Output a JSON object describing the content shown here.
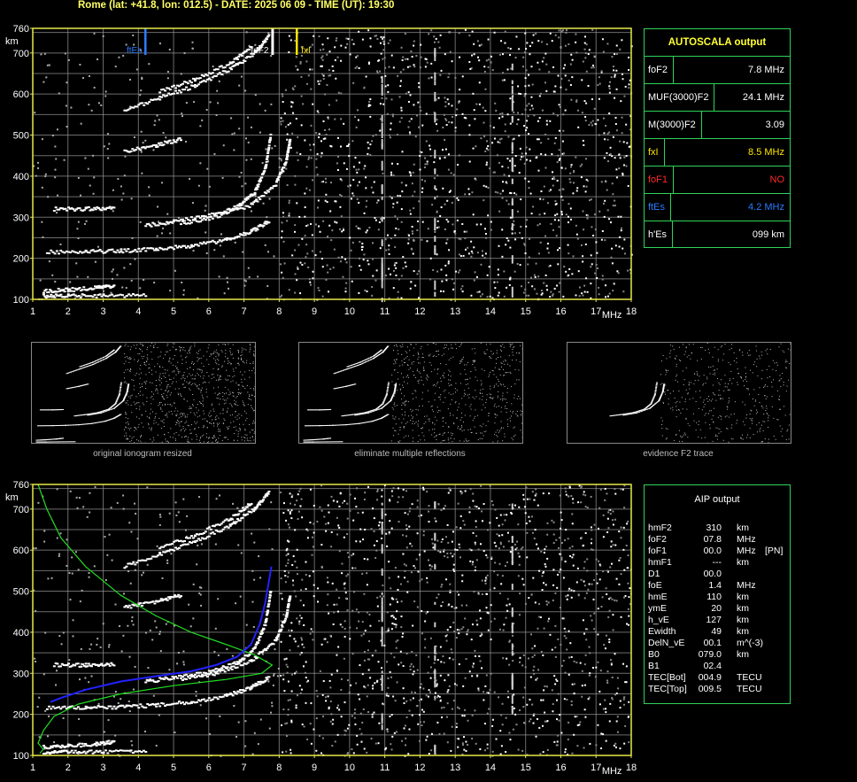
{
  "header": "Rome (lat: +41.8, lon: 012.5) - DATE: 2025 06 09 - TIME (UT): 19:30",
  "axis": {
    "y_unit": "km",
    "x_unit": "MHz",
    "y_ticks": [
      "100",
      "200",
      "300",
      "400",
      "500",
      "600",
      "700",
      "760"
    ],
    "x_ticks": [
      "1",
      "2",
      "3",
      "4",
      "5",
      "6",
      "7",
      "8",
      "9",
      "10",
      "11",
      "12",
      "13",
      "14",
      "15",
      "16",
      "17",
      "18"
    ]
  },
  "markers": {
    "ftEs": "ftEs",
    "foF2": "foF2",
    "fxI": "fxI"
  },
  "colors": {
    "frame": "#e8e84a",
    "grid": "#9a9a9a",
    "panel": "#2fd35a",
    "ftEs": "#2a7cff",
    "fxI": "#ffe600",
    "foF1": "#ff2a2a",
    "model": "#22dd22",
    "profile": "#2222ff"
  },
  "autoscala": {
    "title": "AUTOSCALA output",
    "rows": [
      {
        "label": "foF2",
        "value": "7.8 MHz",
        "color": "#ffffff"
      },
      {
        "label": "MUF(3000)F2",
        "value": "24.1 MHz",
        "color": "#ffffff"
      },
      {
        "label": "M(3000)F2",
        "value": "3.09",
        "color": "#ffffff"
      },
      {
        "label": "fxI",
        "value": "8.5 MHz",
        "color": "#ffe600"
      },
      {
        "label": "foF1",
        "value": "NO",
        "color": "#ff2a2a"
      },
      {
        "label": "ftEs",
        "value": "4.2 MHz",
        "color": "#2a7cff"
      },
      {
        "label": "h'Es",
        "value": "099   km",
        "color": "#ffffff"
      }
    ]
  },
  "thumb_captions": [
    "original ionogram resized",
    "eliminate multiple reflections",
    "evidence F2 trace"
  ],
  "aip": {
    "title": "AIP output",
    "rows": [
      {
        "name": "hmF2",
        "value": "310",
        "unit": "km",
        "extra": ""
      },
      {
        "name": "foF2",
        "value": "07.8",
        "unit": "MHz",
        "extra": ""
      },
      {
        "name": "foF1",
        "value": "00.0",
        "unit": "MHz",
        "extra": "[PN]"
      },
      {
        "name": "hmF1",
        "value": "---",
        "unit": "km",
        "extra": ""
      },
      {
        "name": "D1",
        "value": "00.0",
        "unit": "",
        "extra": ""
      },
      {
        "name": "foE",
        "value": "1.4",
        "unit": "MHz",
        "extra": ""
      },
      {
        "name": "hmE",
        "value": "110",
        "unit": "km",
        "extra": ""
      },
      {
        "name": "ymE",
        "value": "20",
        "unit": "km",
        "extra": ""
      },
      {
        "name": "h_vE",
        "value": "127",
        "unit": "km",
        "extra": ""
      },
      {
        "name": "Ewidth",
        "value": "49",
        "unit": "km",
        "extra": ""
      },
      {
        "name": "DelN_vE",
        "value": "00.1",
        "unit": "m^(-3)",
        "extra": ""
      },
      {
        "name": "B0",
        "value": "079.0",
        "unit": "km",
        "extra": ""
      },
      {
        "name": "B1",
        "value": "02.4",
        "unit": "",
        "extra": ""
      },
      {
        "name": "TEC[Bot]",
        "value": "004.9",
        "unit": "TECU",
        "extra": ""
      },
      {
        "name": "TEC[Top]",
        "value": "009.5",
        "unit": "TECU",
        "extra": ""
      }
    ]
  },
  "chart_data": [
    {
      "type": "scatter",
      "title": "",
      "xlabel": "MHz",
      "ylabel": "km",
      "xlim": [
        1,
        18
      ],
      "ylim": [
        100,
        760
      ],
      "grid": true,
      "vertical_markers": [
        {
          "label": "ftEs",
          "x": 4.2
        },
        {
          "label": "foF2",
          "x": 7.8
        },
        {
          "label": "fxI",
          "x": 8.5
        }
      ],
      "traces": [
        {
          "points": [
            [
              1.3,
              120
            ],
            [
              2,
              123
            ],
            [
              2.8,
              128
            ],
            [
              3.3,
              133
            ]
          ]
        },
        {
          "points": [
            [
              1.3,
              108
            ],
            [
              2,
              108
            ],
            [
              3,
              109
            ],
            [
              4.2,
              110
            ]
          ]
        },
        {
          "points": [
            [
              1.4,
              215
            ],
            [
              2.5,
              216
            ],
            [
              3.5,
              218
            ],
            [
              4.5,
              222
            ],
            [
              5.5,
              230
            ],
            [
              6.5,
              245
            ],
            [
              7.2,
              265
            ],
            [
              7.7,
              290
            ]
          ]
        },
        {
          "points": [
            [
              4.2,
              280
            ],
            [
              5,
              289
            ],
            [
              6,
              303
            ],
            [
              6.8,
              325
            ],
            [
              7.3,
              360
            ],
            [
              7.6,
              420
            ],
            [
              7.75,
              500
            ]
          ]
        },
        {
          "points": [
            [
              5.2,
              285
            ],
            [
              6.2,
              300
            ],
            [
              7.2,
              330
            ],
            [
              7.9,
              380
            ],
            [
              8.2,
              440
            ],
            [
              8.3,
              490
            ]
          ]
        },
        {
          "points": [
            [
              1.6,
              320
            ],
            [
              2.5,
              320
            ],
            [
              3.3,
              322
            ]
          ]
        },
        {
          "points": [
            [
              3.6,
              460
            ],
            [
              4.5,
              475
            ],
            [
              5.2,
              490
            ]
          ]
        },
        {
          "points": [
            [
              3.6,
              560
            ],
            [
              4.6,
              590
            ],
            [
              5.6,
              620
            ],
            [
              6.6,
              660
            ],
            [
              7.3,
              700
            ],
            [
              7.7,
              740
            ]
          ]
        },
        {
          "points": [
            [
              4.6,
              605
            ],
            [
              5.6,
              635
            ],
            [
              6.6,
              675
            ],
            [
              7.2,
              715
            ]
          ]
        }
      ]
    },
    {
      "type": "line",
      "title": "",
      "xlabel": "MHz",
      "ylabel": "km",
      "xlim": [
        1,
        18
      ],
      "ylim": [
        100,
        760
      ],
      "grid": true,
      "series": [
        {
          "type": "line",
          "color": "#22dd22",
          "points": [
            [
              1.15,
              760
            ],
            [
              1.4,
              700
            ],
            [
              1.8,
              630
            ],
            [
              2.5,
              560
            ],
            [
              3.5,
              490
            ],
            [
              4.5,
              440
            ],
            [
              5.5,
              400
            ],
            [
              6.5,
              370
            ],
            [
              7.3,
              345
            ],
            [
              7.8,
              320
            ],
            [
              7.5,
              300
            ],
            [
              6.5,
              285
            ],
            [
              5,
              270
            ],
            [
              3.5,
              250
            ],
            [
              2.3,
              225
            ],
            [
              1.6,
              195
            ],
            [
              1.3,
              160
            ],
            [
              1.15,
              130
            ],
            [
              1.3,
              115
            ],
            [
              1.2,
              105
            ]
          ]
        },
        {
          "type": "line",
          "color": "#2222ff",
          "points": [
            [
              1.5,
              230
            ],
            [
              1.8,
              240
            ],
            [
              2.5,
              260
            ],
            [
              3.5,
              280
            ],
            [
              4.5,
              293
            ],
            [
              5.5,
              305
            ],
            [
              6.2,
              320
            ],
            [
              6.8,
              340
            ],
            [
              7.2,
              370
            ],
            [
              7.45,
              420
            ],
            [
              7.6,
              470
            ],
            [
              7.7,
              520
            ],
            [
              7.78,
              560
            ]
          ]
        }
      ],
      "traces": [
        {
          "points": [
            [
              1.3,
              120
            ],
            [
              2,
              123
            ],
            [
              2.8,
              128
            ],
            [
              3.3,
              133
            ]
          ]
        },
        {
          "points": [
            [
              1.3,
              108
            ],
            [
              2,
              108
            ],
            [
              3,
              109
            ],
            [
              4.2,
              110
            ]
          ]
        },
        {
          "points": [
            [
              1.4,
              215
            ],
            [
              2.5,
              216
            ],
            [
              3.5,
              218
            ],
            [
              4.5,
              222
            ],
            [
              5.5,
              230
            ],
            [
              6.5,
              245
            ],
            [
              7.2,
              265
            ],
            [
              7.7,
              290
            ]
          ]
        },
        {
          "points": [
            [
              4.2,
              280
            ],
            [
              5,
              289
            ],
            [
              6,
              303
            ],
            [
              6.8,
              325
            ],
            [
              7.3,
              360
            ],
            [
              7.6,
              420
            ],
            [
              7.75,
              500
            ]
          ]
        },
        {
          "points": [
            [
              5.2,
              285
            ],
            [
              6.2,
              300
            ],
            [
              7.2,
              330
            ],
            [
              7.9,
              380
            ],
            [
              8.2,
              440
            ],
            [
              8.3,
              490
            ]
          ]
        },
        {
          "points": [
            [
              1.6,
              320
            ],
            [
              2.5,
              320
            ],
            [
              3.3,
              322
            ]
          ]
        },
        {
          "points": [
            [
              3.6,
              460
            ],
            [
              4.5,
              475
            ],
            [
              5.2,
              490
            ]
          ]
        },
        {
          "points": [
            [
              3.6,
              560
            ],
            [
              4.6,
              590
            ],
            [
              5.6,
              620
            ],
            [
              6.6,
              660
            ],
            [
              7.3,
              700
            ],
            [
              7.7,
              740
            ]
          ]
        },
        {
          "points": [
            [
              4.6,
              605
            ],
            [
              5.6,
              635
            ],
            [
              6.6,
              675
            ],
            [
              7.2,
              715
            ]
          ]
        }
      ]
    }
  ]
}
